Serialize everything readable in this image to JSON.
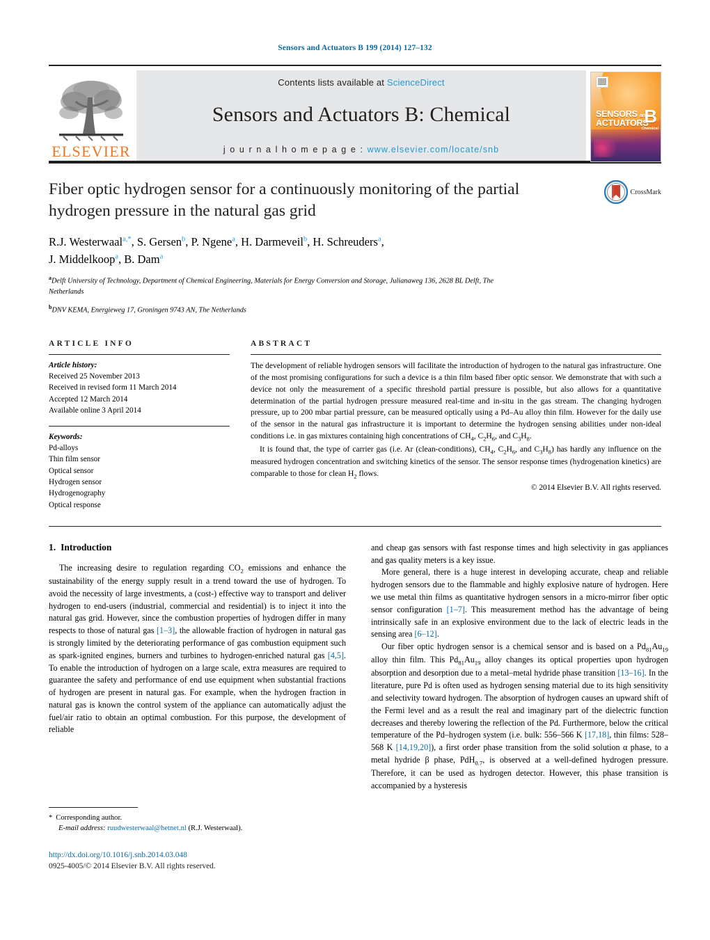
{
  "running_head": "Sensors and Actuators B 199 (2014) 127–132",
  "masthead": {
    "contents_prefix": "Contents lists available at ",
    "sciencedirect": "ScienceDirect",
    "journal_title": "Sensors and Actuators B: Chemical",
    "homepage_prefix": "j o u r n a l   h o m e p a g e :",
    "homepage_url": "www.elsevier.com/locate/snb",
    "publisher": "ELSEVIER",
    "cover": {
      "line1": "SENSORS",
      "line1_small": "and",
      "line2": "ACTUATORS",
      "letter": "B",
      "letter_sub": "Chemical"
    },
    "colors": {
      "link": "#1f9ad6",
      "band": "#e6e7e8",
      "publisher_orange": "#ef7622"
    }
  },
  "title": "Fiber optic hydrogen sensor for a continuously monitoring of the partial hydrogen pressure in the natural gas grid",
  "crossmark_label": "CrossMark",
  "authors": [
    {
      "name": "R.J. Westerwaal",
      "sup": "a,*"
    },
    {
      "name": "S. Gersen",
      "sup": "b"
    },
    {
      "name": "P. Ngene",
      "sup": "a"
    },
    {
      "name": "H. Darmeveil",
      "sup": "b"
    },
    {
      "name": "H. Schreuders",
      "sup": "a"
    },
    {
      "name": "J. Middelkoop",
      "sup": "a"
    },
    {
      "name": "B. Dam",
      "sup": "a"
    }
  ],
  "affiliations": [
    {
      "marker": "a",
      "text": "Delft University of Technology, Department of Chemical Engineering, Materials for Energy Conversion and Storage, Julianaweg 136, 2628 BL Delft, The Netherlands"
    },
    {
      "marker": "b",
      "text": "DNV KEMA, Energieweg 17, Groningen 9743 AN, The Netherlands"
    }
  ],
  "article_info": {
    "heading": "ARTICLE INFO",
    "history_label": "Article history:",
    "history": [
      "Received 25 November 2013",
      "Received in revised form 11 March 2014",
      "Accepted 12 March 2014",
      "Available online 3 April 2014"
    ],
    "keywords_label": "Keywords:",
    "keywords": [
      "Pd-alloys",
      "Thin film sensor",
      "Optical sensor",
      "Hydrogen sensor",
      "Hydrogenography",
      "Optical response"
    ]
  },
  "abstract": {
    "heading": "ABSTRACT",
    "paragraph1_part1": "The development of reliable hydrogen sensors will facilitate the introduction of hydrogen to the natural gas infrastructure. One of the most promising configurations for such a device is a thin film based fiber optic sensor. We demonstrate that with such a device not only the measurement of a specific threshold partial pressure is possible, but also allows for a quantitative determination of the partial hydrogen pressure measured real-time and in-situ in the gas stream. The changing hydrogen pressure, up to 200 mbar partial pressure, can be measured optically using a Pd–Au alloy thin film. However for the daily use of the sensor in the natural gas infrastructure it is important to determine the hydrogen sensing abilities under non-ideal conditions i.e. in gas mixtures containing high concentrations of CH",
    "paragraph1_part2": ", C",
    "paragraph1_part3": "H",
    "paragraph1_part4": ", and C",
    "paragraph1_part5": "H",
    "paragraph1_end": ".",
    "paragraph2_a": "It is found that, the type of carrier gas (i.e. Ar (clean-conditions), CH",
    "paragraph2_b": ", C",
    "paragraph2_c": "H",
    "paragraph2_d": ", and C",
    "paragraph2_e": "H",
    "paragraph2_f": ") has hardly any influence on the measured hydrogen concentration and switching kinetics of the sensor. The sensor response times (hydrogenation kinetics) are comparable to those for clean H",
    "paragraph2_g": " flows.",
    "copyright": "© 2014 Elsevier B.V. All rights reserved."
  },
  "intro": {
    "number": "1.",
    "heading": "Introduction",
    "left_p1_a": "The increasing desire to regulation regarding CO",
    "left_p1_b": " emissions and enhance the sustainability of the energy supply result in a trend toward the use of hydrogen. To avoid the necessity of large investments, a (cost-) effective way to transport and deliver hydrogen to end-users (industrial, commercial and residential) is to inject it into the natural gas grid. However, since the combustion properties of hydrogen differ in many respects to those of natural gas ",
    "ref_1_3": "[1–3]",
    "left_p1_c": ", the allowable fraction of hydrogen in natural gas is strongly limited by the deteriorating performance of gas combustion equipment such as spark-ignited engines, burners and turbines to hydrogen-enriched natural gas ",
    "ref_4_5": "[4,5]",
    "left_p1_d": ". To enable the introduction of hydrogen on a large scale, extra measures are required to guarantee the safety and performance of end use equipment when substantial fractions of hydrogen are present in natural gas. For example, when the hydrogen fraction in natural gas is known the control system of the appliance can automatically adjust the fuel/air ratio to obtain an optimal combustion. For this purpose, the development of reliable",
    "right_p1_cont": "and cheap gas sensors with fast response times and high selectivity in gas appliances and gas quality meters is a key issue.",
    "right_p2_a": "More general, there is a huge interest in developing accurate, cheap and reliable hydrogen sensors due to the flammable and highly explosive nature of hydrogen. Here we use metal thin films as quantitative hydrogen sensors in a micro-mirror fiber optic sensor configuration ",
    "ref_1_7": "[1–7]",
    "right_p2_b": ". This measurement method has the advantage of being intrinsically safe in an explosive environment due to the lack of electric leads in the sensing area ",
    "ref_6_12": "[6–12]",
    "right_p2_c": ".",
    "right_p3_a": "Our fiber optic hydrogen sensor is a chemical sensor and is based on a Pd",
    "right_p3_sub1": "81",
    "right_p3_b": "Au",
    "right_p3_sub2": "19",
    "right_p3_c": " alloy thin film. This Pd",
    "right_p3_sub3": "81",
    "right_p3_d": "Au",
    "right_p3_sub4": "19",
    "right_p3_e": " alloy changes its optical properties upon hydrogen absorption and desorption due to a metal–metal hydride phase transition ",
    "ref_13_16": "[13–16]",
    "right_p3_f": ". In the literature, pure Pd is often used as hydrogen sensing material due to its high sensitivity and selectivity toward hydrogen. The absorption of hydrogen causes an upward shift of the Fermi level and as a result the real and imaginary part of the dielectric function decreases and thereby lowering the reflection of the Pd. Furthermore, below the critical temperature of the Pd–hydrogen system (i.e. bulk: 556–566 K ",
    "ref_17_18": "[17,18]",
    "right_p3_g": ", thin films: 528–568 K ",
    "ref_14_19_20": "[14,19,20]",
    "right_p3_h": "), a first order phase transition from the solid solution α phase, to a metal hydride β phase, PdH",
    "right_p3_sub5": "0.7",
    "right_p3_i": ", is observed at a well-defined hydrogen pressure. Therefore, it can be used as hydrogen detector. However, this phase transition is accompanied by a hysteresis"
  },
  "footer": {
    "star": "*",
    "corresponding": "Corresponding author.",
    "email_label": "E-mail address:",
    "email": "ruudwesterwaal@hetnet.nl",
    "email_owner": "(R.J. Westerwaal).",
    "doi": "http://dx.doi.org/10.1016/j.snb.2014.03.048",
    "issn_line": "0925-4005/© 2014 Elsevier B.V. All rights reserved."
  }
}
